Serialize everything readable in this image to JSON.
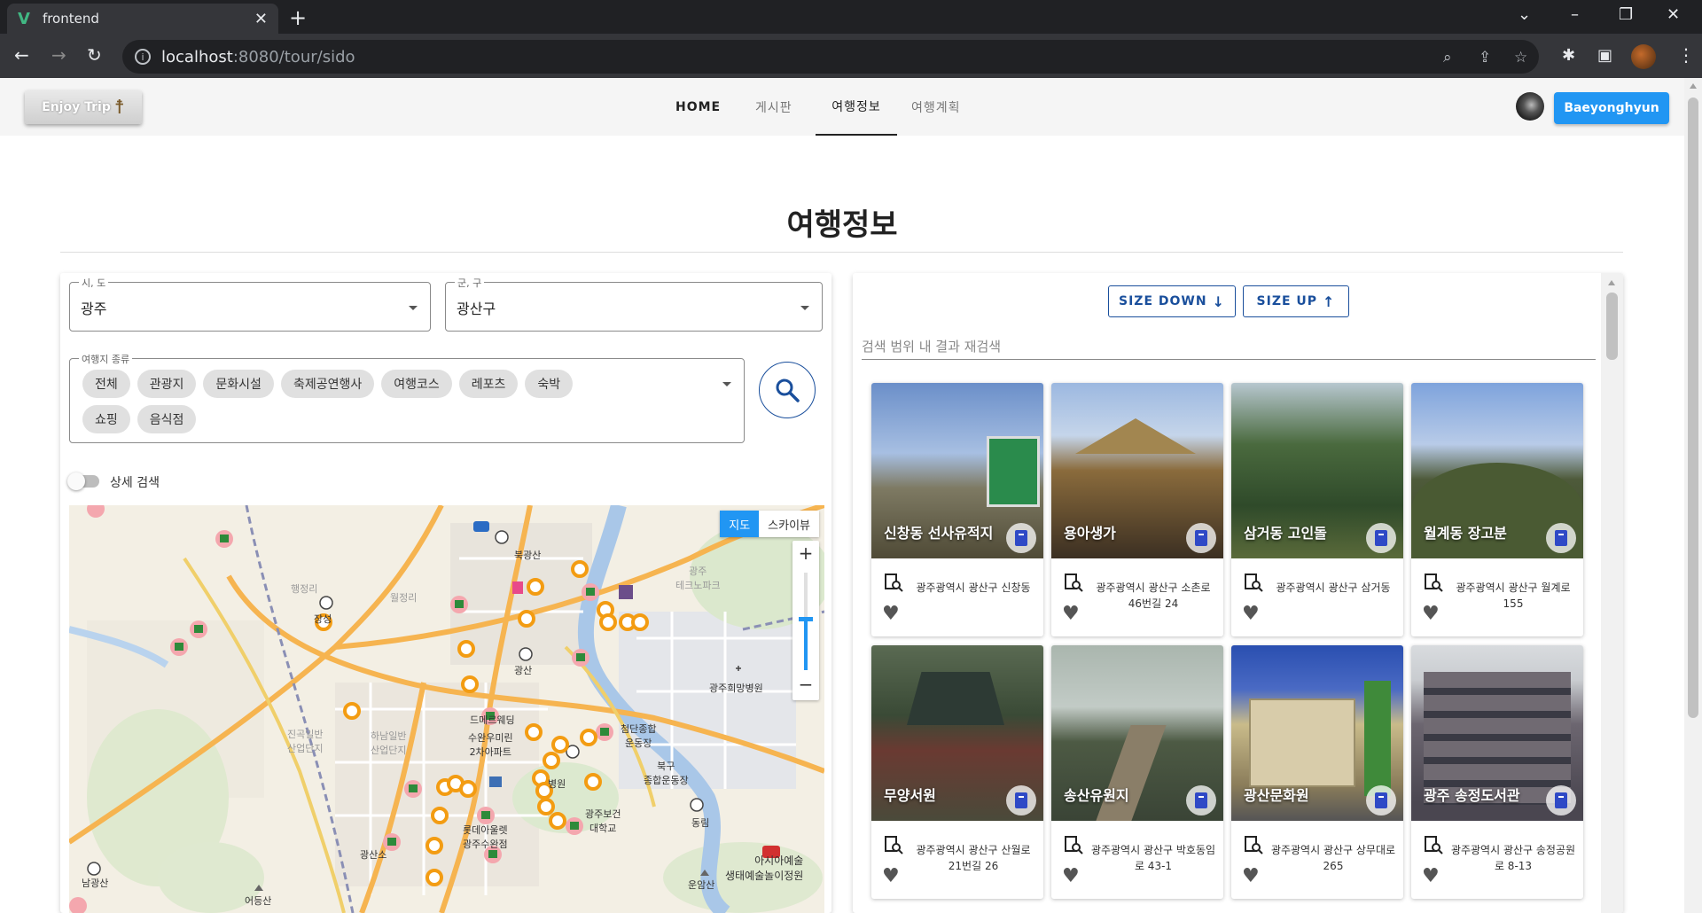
{
  "browser": {
    "tab_title": "frontend",
    "url_host": "localhost",
    "url_rest": ":8080/tour/sido"
  },
  "nav": {
    "logo_text": "Enjoy Trip",
    "items": [
      {
        "label": "HOME"
      },
      {
        "label": "게시판"
      },
      {
        "label": "여행정보"
      },
      {
        "label": "여행계획"
      }
    ],
    "user_button": "Baeyonghyun"
  },
  "page": {
    "title": "여행정보"
  },
  "filters": {
    "sido": {
      "label": "시, 도",
      "value": "광주"
    },
    "gugun": {
      "label": "군, 구",
      "value": "광산구"
    },
    "type": {
      "label": "여행지 종류",
      "chips": [
        "전체",
        "관광지",
        "문화시설",
        "축제공연행사",
        "여행코스",
        "레포츠",
        "숙박",
        "쇼핑",
        "음식점"
      ]
    },
    "detail_search_label": "상세 검색"
  },
  "map": {
    "type_map": "지도",
    "type_sky": "스카이뷰",
    "labels": [
      {
        "text": "북광산"
      },
      {
        "text": "광산"
      },
      {
        "text": "광주희망병원"
      },
      {
        "text": "드메르웨딩"
      },
      {
        "text": "수완우미린\n2차아파트"
      },
      {
        "text": "첨단종합\n운동장"
      },
      {
        "text": "북구\n종합운동장"
      },
      {
        "text": "병원"
      },
      {
        "text": "광주보건\n대학교"
      },
      {
        "text": "롯데아울렛\n광주수완점"
      },
      {
        "text": "동림"
      },
      {
        "text": "광산소"
      },
      {
        "text": "남광산"
      },
      {
        "text": "어등산"
      },
      {
        "text": "운암산"
      },
      {
        "text": "아시아예술\n생태예술놀이정원"
      },
      {
        "text": "행정리"
      },
      {
        "text": "월정리"
      },
      {
        "text": "하남일반\n산업단지"
      },
      {
        "text": "진곡일반\n산업단지"
      },
      {
        "text": "광주\n테크노파크"
      },
      {
        "text": "장성"
      }
    ]
  },
  "results": {
    "size_down": "SIZE DOWN",
    "size_up": "SIZE UP",
    "search_placeholder": "검색 범위 내 결과 재검색",
    "cards": [
      {
        "name": "신창동 선사유적지",
        "address": "광주광역시 광산구 신창동"
      },
      {
        "name": "용아생가",
        "address": "광주광역시 광산구 소촌로46번길 24"
      },
      {
        "name": "삼거동 고인돌",
        "address": "광주광역시 광산구 삼거동"
      },
      {
        "name": "월계동 장고분",
        "address": "광주광역시 광산구 월계로 155"
      },
      {
        "name": "무양서원",
        "address": "광주광역시 광산구 산월로21번길 26"
      },
      {
        "name": "송산유원지",
        "address": "광주광역시 광산구 박호동임로 43-1"
      },
      {
        "name": "광산문화원",
        "address": "광주광역시 광산구 상무대로 265"
      },
      {
        "name": "광주 송정도서관",
        "address": "광주광역시 광산구 송정공원로 8-13"
      }
    ]
  }
}
